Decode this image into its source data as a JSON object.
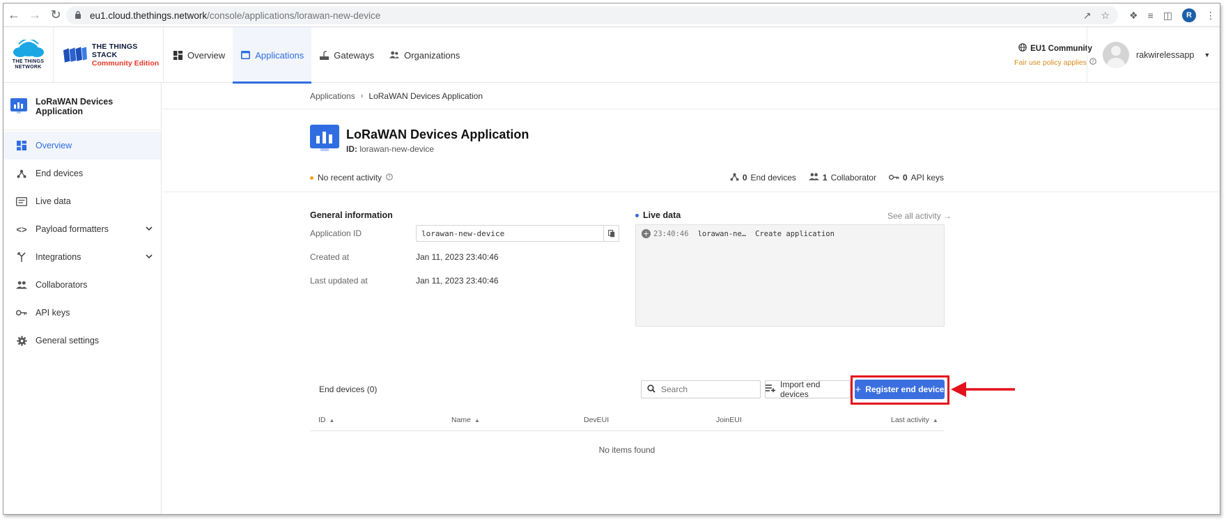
{
  "browser": {
    "url_host": "eu1.cloud.thethings.network",
    "url_path": "/console/applications/lorawan-new-device",
    "profile_initial": "R"
  },
  "header": {
    "ttn_logo_line1": "THE THINGS",
    "ttn_logo_line2": "NETWORK",
    "tts_line1": "THE THINGS STACK",
    "tts_line2": "Community Edition",
    "nav": [
      {
        "label": "Overview",
        "icon": "dashboard-icon",
        "active": false
      },
      {
        "label": "Applications",
        "icon": "application-icon",
        "active": true
      },
      {
        "label": "Gateways",
        "icon": "gateway-icon",
        "active": false
      },
      {
        "label": "Organizations",
        "icon": "organizations-icon",
        "active": false
      }
    ],
    "cluster_label": "EU1 Community",
    "fair_use": "Fair use policy applies",
    "username": "rakwirelessapp"
  },
  "sidebar": {
    "app_name": "LoRaWAN Devices Application",
    "items": [
      {
        "label": "Overview",
        "icon": "dashboard-icon",
        "active": true,
        "expandable": false
      },
      {
        "label": "End devices",
        "icon": "device-icon",
        "active": false,
        "expandable": false
      },
      {
        "label": "Live data",
        "icon": "live-data-icon",
        "active": false,
        "expandable": false
      },
      {
        "label": "Payload formatters",
        "icon": "code-icon",
        "active": false,
        "expandable": true
      },
      {
        "label": "Integrations",
        "icon": "integration-icon",
        "active": false,
        "expandable": true
      },
      {
        "label": "Collaborators",
        "icon": "collaborators-icon",
        "active": false,
        "expandable": false
      },
      {
        "label": "API keys",
        "icon": "key-icon",
        "active": false,
        "expandable": false
      },
      {
        "label": "General settings",
        "icon": "gear-icon",
        "active": false,
        "expandable": false
      }
    ]
  },
  "breadcrumb": {
    "root": "Applications",
    "current": "LoRaWAN Devices Application"
  },
  "app": {
    "title": "LoRaWAN Devices Application",
    "id_label": "ID:",
    "id_value": "lorawan-new-device",
    "activity": "No recent activity",
    "end_devices_count": "0",
    "end_devices_label": "End devices",
    "collaborators_count": "1",
    "collaborators_label": "Collaborator",
    "api_keys_count": "0",
    "api_keys_label": "API keys"
  },
  "general": {
    "title": "General information",
    "app_id_label": "Application ID",
    "app_id_value": "lorawan-new-device",
    "created_label": "Created at",
    "created_value": "Jan 11, 2023 23:40:46",
    "updated_label": "Last updated at",
    "updated_value": "Jan 11, 2023 23:40:46"
  },
  "live": {
    "title": "Live data",
    "see_all": "See all activity →",
    "events": [
      {
        "time": "23:40:46",
        "device": "lorawan-ne…",
        "message": "Create application"
      }
    ]
  },
  "end_devices": {
    "title": "End devices (0)",
    "search_placeholder": "Search",
    "import_label": "Import end devices",
    "register_label": "Register end device",
    "columns": [
      "ID",
      "Name",
      "DevEUI",
      "JoinEUI",
      "Last activity"
    ],
    "empty": "No items found"
  },
  "colors": {
    "accent": "#2f6de1",
    "register_button": "#3b6fdf",
    "highlight": "#e3121b",
    "fair_use": "#d88a17"
  }
}
